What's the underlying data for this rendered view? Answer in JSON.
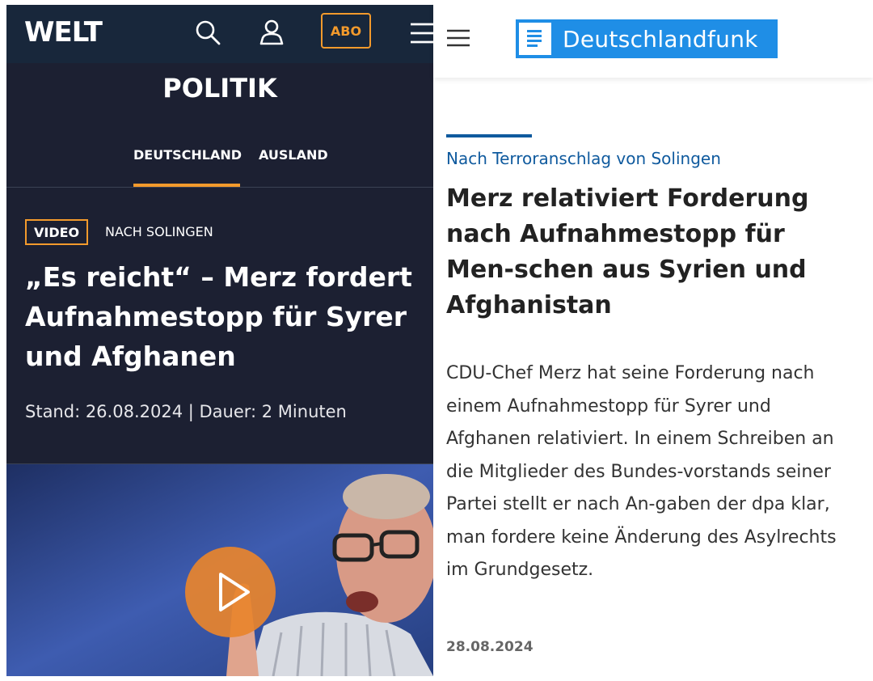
{
  "welt": {
    "logo": "WELT",
    "subscribe_label": "ABO",
    "section_title": "POLITIK",
    "tabs": [
      {
        "label": "DEUTSCHLAND",
        "active": true
      },
      {
        "label": "AUSLAND",
        "active": false
      }
    ],
    "badge": "VIDEO",
    "kicker": "NACH SOLINGEN",
    "headline": "„Es reicht“ – Merz fordert Aufnahmestopp für Syrer und Afghanen",
    "meta": "Stand: 26.08.2024 | Dauer: 2 Minuten",
    "icons": [
      "search-icon",
      "user-icon",
      "menu-icon",
      "play-icon"
    ],
    "accent_color": "#f39a2c",
    "background_color": "#1c2032"
  },
  "dlf": {
    "logo": "Deutschlandfunk",
    "kicker": "Nach Terroranschlag von Solingen",
    "headline": "Merz relativiert Forderung nach Aufnahmestopp für Men-schen aus Syrien und Afghanistan",
    "body": "CDU-Chef Merz hat seine Forderung nach einem Aufnahmestopp für Syrer und Afghanen relativiert. In einem Schreiben an die Mitglieder des Bundes-vorstands seiner Partei stellt er nach An-gaben der dpa klar, man fordere keine Änderung des Asylrechts im Grundgesetz.",
    "date": "28.08.2024",
    "icons": [
      "menu-icon",
      "document-logo-icon"
    ],
    "brand_color": "#1f8ee6",
    "kicker_color": "#0f5a9e"
  }
}
